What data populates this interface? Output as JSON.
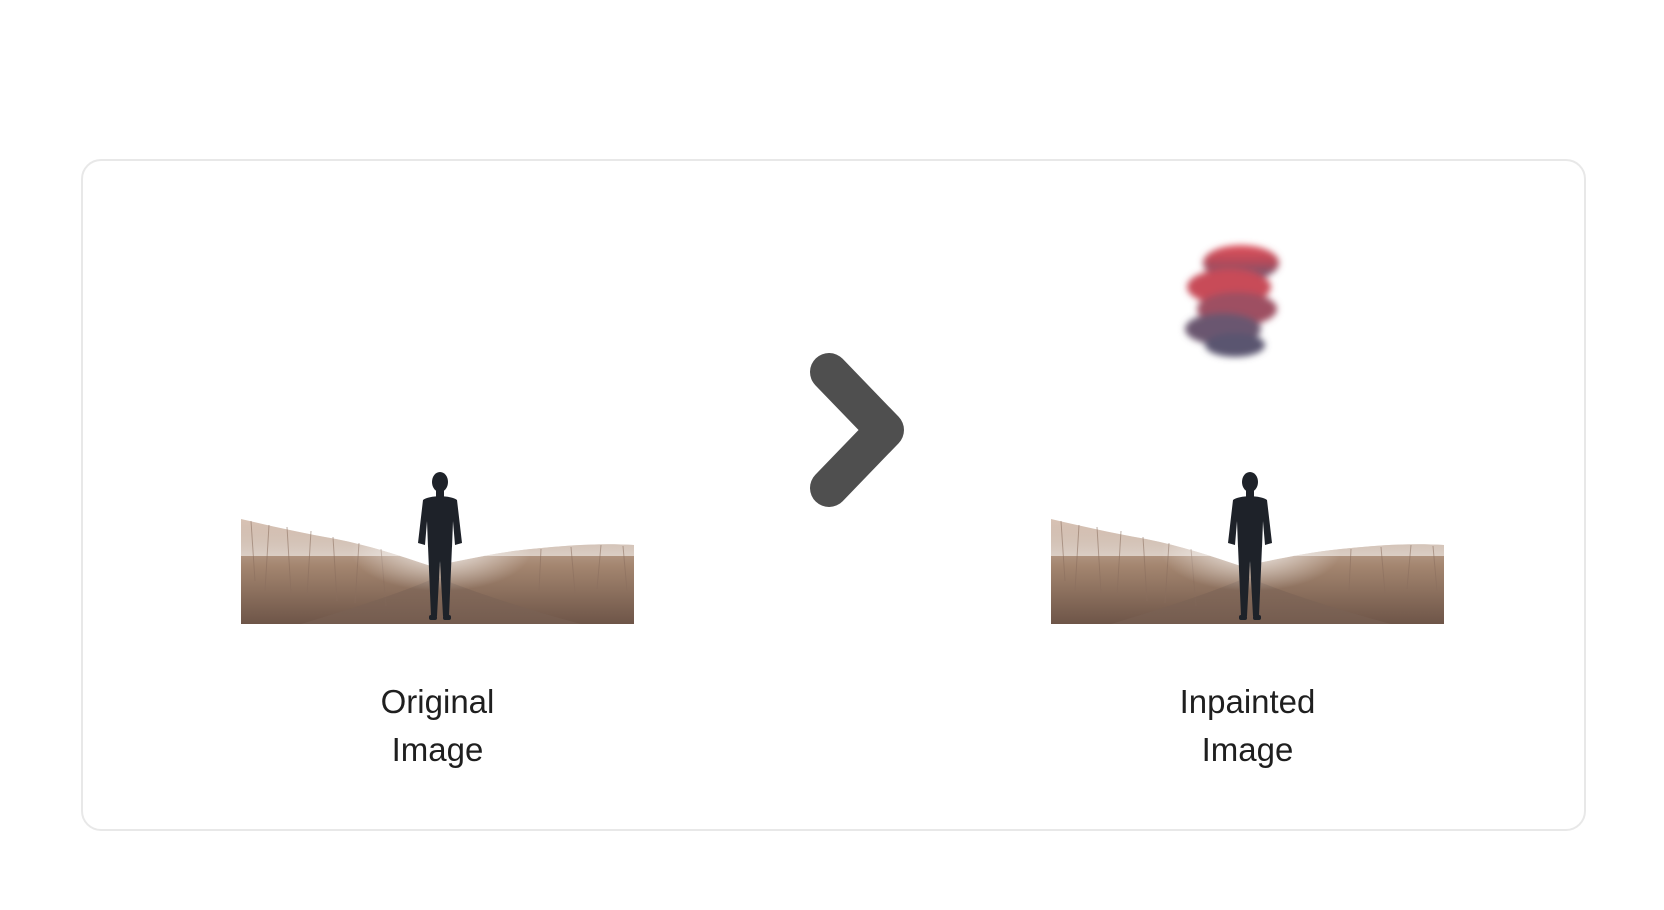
{
  "comparison": {
    "original": {
      "caption_line1": "Original",
      "caption_line2": "Image"
    },
    "arrow_icon": "chevron-right-icon",
    "inpainted": {
      "caption_line1": "Inpainted",
      "caption_line2": "Image"
    }
  },
  "colors": {
    "arrow": "#4f4f4f",
    "card_border": "#e8e8e8",
    "caption_text": "#1f1f1f",
    "cloud_top": "#d2434f",
    "cloud_bottom": "#5d5a78"
  }
}
